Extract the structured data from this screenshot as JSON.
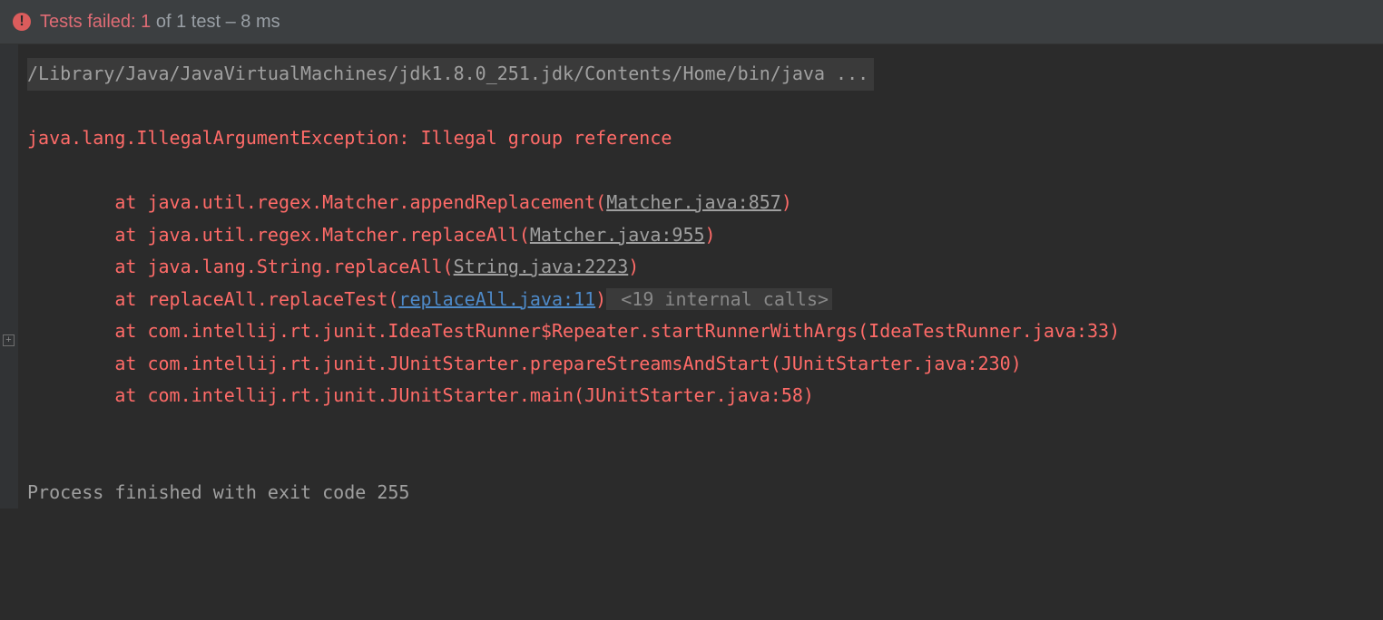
{
  "header": {
    "label_failed": "Tests failed:",
    "count": "1",
    "of_text": "of 1 test",
    "sep": "–",
    "time": "8 ms"
  },
  "console": {
    "command_line": "/Library/Java/JavaVirtualMachines/jdk1.8.0_251.jdk/Contents/Home/bin/java ...",
    "exception": "java.lang.IllegalArgumentException: Illegal group reference",
    "indent": "\t",
    "at": "at ",
    "frames": [
      {
        "prefix": "java.util.regex.Matcher.appendReplacement(",
        "link": "Matcher.java:857",
        "link_type": "src",
        "suffix_st": ")"
      },
      {
        "prefix": "java.util.regex.Matcher.replaceAll(",
        "link": "Matcher.java:955",
        "link_type": "src",
        "suffix_st": ")"
      },
      {
        "prefix": "java.lang.String.replaceAll(",
        "link": "String.java:2223",
        "link_type": "src",
        "suffix_st": ")"
      },
      {
        "prefix": "replaceAll.replaceTest(",
        "link": "replaceAll.java:11",
        "link_type": "own",
        "suffix_st": ")",
        "collapsed": " <19 internal calls>"
      },
      {
        "prefix": "com.intellij.rt.junit.IdeaTestRunner$Repeater.startRunnerWithArgs(IdeaTestRunner.java:33)"
      },
      {
        "prefix": "com.intellij.rt.junit.JUnitStarter.prepareStreamsAndStart(JUnitStarter.java:230)"
      },
      {
        "prefix": "com.intellij.rt.junit.JUnitStarter.main(JUnitStarter.java:58)"
      }
    ],
    "exit_line": "Process finished with exit code 255"
  },
  "expand_glyph": "+"
}
